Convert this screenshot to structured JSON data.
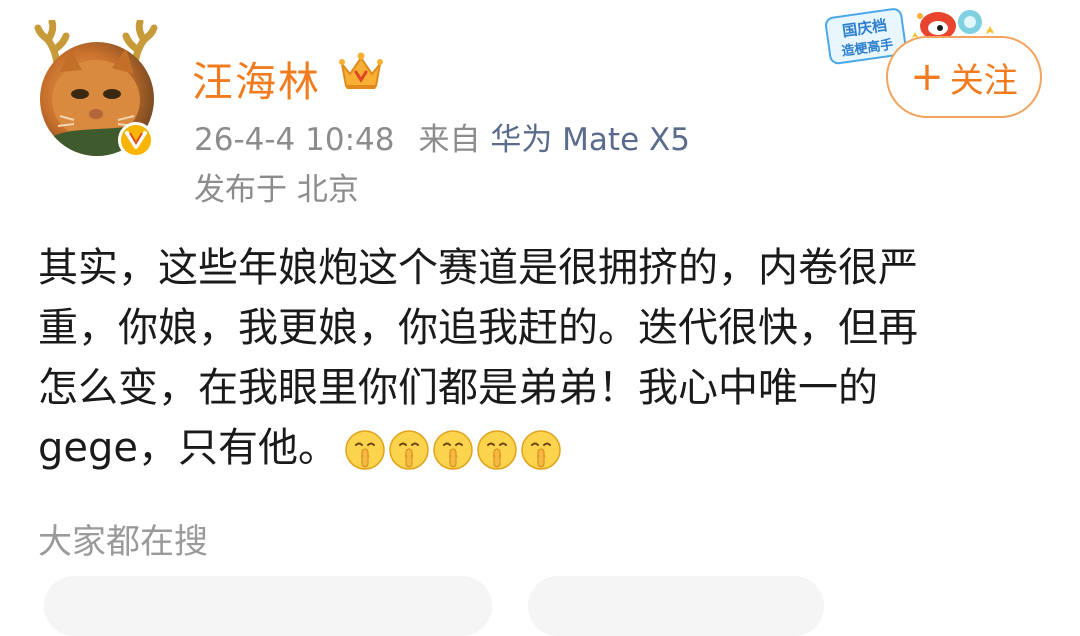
{
  "post": {
    "author": {
      "name": "汪海林",
      "verified": true
    },
    "timestamp": "26-4-4 10:48",
    "source_prefix": "来自",
    "device": "华为 Mate X5",
    "location": "发布于 北京",
    "text_lines": [
      "其实，这些年娘炮这个赛道是很拥挤的，内卷很严",
      "重，你娘，我更娘，你追我赶的。迭代很快，但再",
      "怎么变，在我眼里你们都是弟弟！我心中唯一的",
      "gege，只有他。"
    ],
    "emojis": [
      "shushing-face-icon",
      "shushing-face-icon",
      "shushing-face-icon",
      "shushing-face-icon",
      "shushing-face-icon"
    ]
  },
  "follow_button": {
    "plus": "+",
    "label": "关注"
  },
  "decoration": {
    "badge_line1": "国庆档",
    "badge_line2": "造梗高手"
  },
  "trending": {
    "title": "大家都在搜"
  },
  "colors": {
    "username": "#f07c1f",
    "device_link": "#5b6b8c",
    "meta": "#8c8c8c",
    "follow_border": "#f3a35c"
  }
}
